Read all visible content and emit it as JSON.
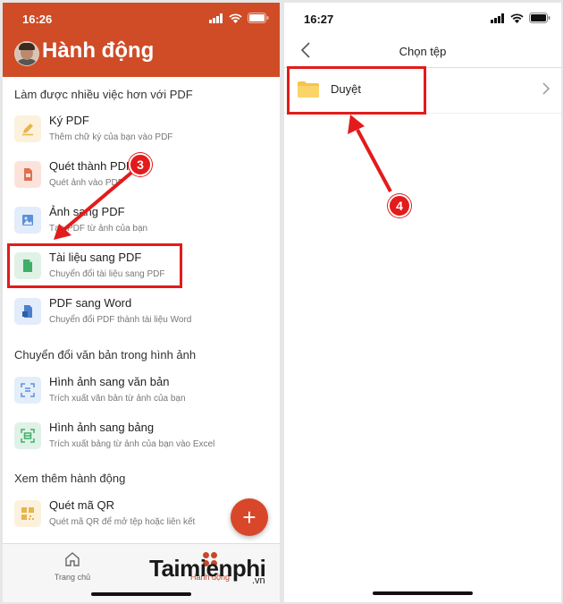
{
  "left": {
    "status": {
      "time": "16:26"
    },
    "header": {
      "title": "Hành động"
    },
    "sections": [
      {
        "title": "Làm được nhiều việc hơn với PDF"
      },
      {
        "title": "Chuyển đổi văn bản trong hình ảnh"
      },
      {
        "title": "Xem thêm hành động"
      }
    ],
    "items": [
      {
        "title": "Ký PDF",
        "subtitle": "Thêm chữ ký của bạn vào PDF",
        "icon": "pen-icon"
      },
      {
        "title": "Quét thành PDF",
        "subtitle": "Quét ảnh vào PDF",
        "icon": "scan-document-icon"
      },
      {
        "title": "Ảnh sang PDF",
        "subtitle": "Tạo PDF từ ảnh của bạn",
        "icon": "image-icon"
      },
      {
        "title": "Tài liệu sang PDF",
        "subtitle": "Chuyển đổi tài liệu sang PDF",
        "icon": "document-icon"
      },
      {
        "title": "PDF sang Word",
        "subtitle": "Chuyển đổi PDF thành tài liệu Word",
        "icon": "word-icon"
      },
      {
        "title": "Hình ảnh sang văn bản",
        "subtitle": "Trích xuất văn bản từ ảnh của bạn",
        "icon": "text-scan-icon"
      },
      {
        "title": "Hình ảnh sang bảng",
        "subtitle": "Trích xuất bảng từ ảnh của bạn vào Excel",
        "icon": "table-scan-icon"
      },
      {
        "title": "Quét mã QR",
        "subtitle": "Quét mã QR để mở tệp hoặc liên kết",
        "icon": "qr-code-icon"
      }
    ],
    "fab": {
      "label": "+"
    },
    "tabs": [
      {
        "label": "Trang chủ",
        "icon": "home-icon"
      },
      {
        "label": "Hành động",
        "icon": "actions-grid-icon"
      }
    ],
    "step_badge": "3"
  },
  "right": {
    "status": {
      "time": "16:27"
    },
    "nav": {
      "title": "Chọn tệp"
    },
    "row": {
      "label": "Duyệt",
      "icon": "folder-icon"
    },
    "step_badge": "4"
  },
  "watermark": {
    "brand": "Taimienphi",
    "suffix": ".vn"
  },
  "colors": {
    "accent": "#cf4c27",
    "annotation": "#e31b1b"
  }
}
